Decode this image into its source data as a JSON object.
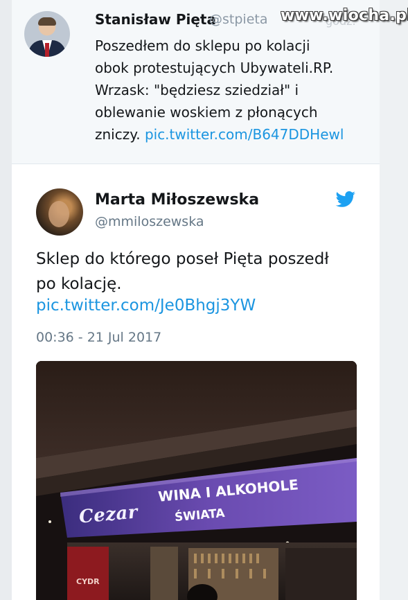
{
  "watermark": {
    "text": "www.wiocha.pl",
    "faded_text": "godz."
  },
  "quoted_tweet": {
    "name": "Stanisław Pięta",
    "handle": "@stpieta",
    "text_lines": [
      "Poszedłem do sklepu po kolacji",
      "obok protestujących Ubywateli.RP.",
      "Wrzask: \"będziesz sziedział\" i",
      "oblewanie woskiem z płonących",
      "zniczy."
    ],
    "link": "pic.twitter.com/B647DDHewl"
  },
  "tweet": {
    "name": "Marta Miłoszewska",
    "handle": "@mmiloszewska",
    "text_lines": [
      "Sklep do którego poseł Pięta poszedł",
      "po kolację."
    ],
    "link": "pic.twitter.com/Je0Bhgj3YW",
    "timestamp": "00:36 - 21 Jul 2017"
  },
  "photo": {
    "sign_brand": "Cezar",
    "sign_line1": "WINA I ALKOHOLE",
    "sign_line2": "ŚWIATA",
    "poster_text": "CYDR"
  },
  "colors": {
    "link": "#1b95e0",
    "twitter_bird": "#1da1f2",
    "sign_background": "#5b3f9e"
  },
  "icons": {
    "twitter": "twitter-bird-icon"
  }
}
